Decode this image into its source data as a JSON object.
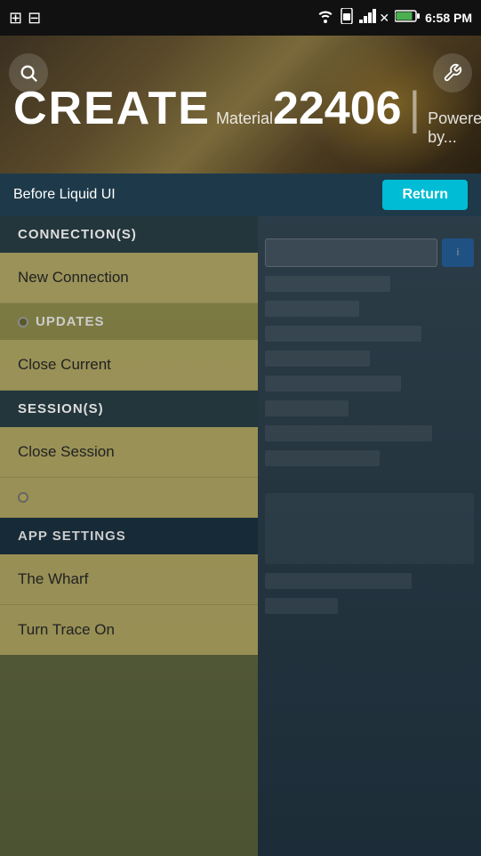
{
  "statusBar": {
    "time": "6:58 PM",
    "icons": [
      "wifi",
      "sim",
      "signal",
      "battery"
    ]
  },
  "header": {
    "createLabel": "CREATE",
    "materialLabel": "Material",
    "numberLabel": "22406",
    "divider": "|",
    "poweredLabel": "Powered by...",
    "searchIcon": "search-icon",
    "wrenchIcon": "wrench-icon"
  },
  "navBar": {
    "label": "Before Liquid UI",
    "returnButton": "Return"
  },
  "menu": {
    "sections": [
      {
        "type": "section-header",
        "label": "CONNECTION(S)"
      },
      {
        "type": "item",
        "label": "New Connection",
        "hasDot": false
      },
      {
        "type": "section-header",
        "label": "● UPDATES"
      },
      {
        "type": "item",
        "label": "Close Current",
        "hasDot": false
      },
      {
        "type": "section-header",
        "label": "SESSION(S)"
      },
      {
        "type": "item",
        "label": "Close Session",
        "hasDot": false
      },
      {
        "type": "item",
        "label": "",
        "hasDot": true,
        "isDotOnly": true
      },
      {
        "type": "section-header",
        "label": "APP SETTINGS",
        "isDark": true
      },
      {
        "type": "item",
        "label": "The Wharf",
        "hasDot": false
      },
      {
        "type": "item",
        "label": "Turn Trace On",
        "hasDot": false
      }
    ]
  }
}
